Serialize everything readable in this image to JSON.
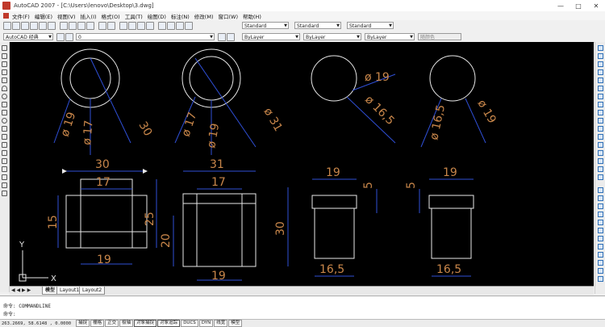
{
  "window": {
    "title": "AutoCAD 2007 - [C:\\Users\\lenovo\\Desktop\\3.dwg]",
    "controls": [
      "—",
      "□",
      "✕"
    ]
  },
  "menu": {
    "items": [
      "文件(F)",
      "编辑(E)",
      "视图(V)",
      "插入(I)",
      "格式(O)",
      "工具(T)",
      "绘图(D)",
      "标注(N)",
      "修改(M)",
      "窗口(W)",
      "帮助(H)"
    ]
  },
  "toolbar": {
    "workspace": "AutoCAD 经典",
    "layer": "0",
    "text_style": "Standard",
    "dim_style": "Standard",
    "table_style": "Standard",
    "color": "ByLayer",
    "linetype": "ByLayer",
    "lineweight": "ByLayer",
    "plotstyle": "随颜色"
  },
  "drawing": {
    "circle_dims": [
      {
        "items": [
          "ø 19",
          "ø 17",
          "30"
        ]
      },
      {
        "items": [
          "ø 17",
          "ø 19",
          "ø 31"
        ]
      },
      {
        "items": [
          "ø 19",
          "ø 16,5"
        ]
      },
      {
        "items": [
          "ø 16,5",
          "ø 19"
        ]
      }
    ],
    "views": [
      {
        "top": "30",
        "mid": "17",
        "left": "15",
        "right": "25",
        "bottom": "19"
      },
      {
        "top": "31",
        "mid": "17",
        "left": "20",
        "right": "30",
        "bottom": "19"
      },
      {
        "top": "19",
        "right": "5",
        "bottom": "16,5"
      },
      {
        "left": "5",
        "top": "19",
        "bottom": "16,5"
      }
    ],
    "ucs_x": "X",
    "ucs_y": "Y"
  },
  "layout_tabs": [
    "模型",
    "Layout1",
    "Layout2"
  ],
  "command": {
    "history": "命令: COMMANDLINE",
    "prompt": "命令:"
  },
  "status": {
    "coords": "263.2669, 58.6148 , 0.0000",
    "buttons": [
      "捕捉",
      "栅格",
      "正交",
      "极轴",
      "对象捕捉",
      "对象追踪",
      "DUCS",
      "DYN",
      "线宽",
      "模型"
    ]
  },
  "colors": {
    "canvas": "#000000",
    "geometry": "#e8e8e8",
    "dimension": "#2f4fd6",
    "dim_text": "#c8864a"
  }
}
